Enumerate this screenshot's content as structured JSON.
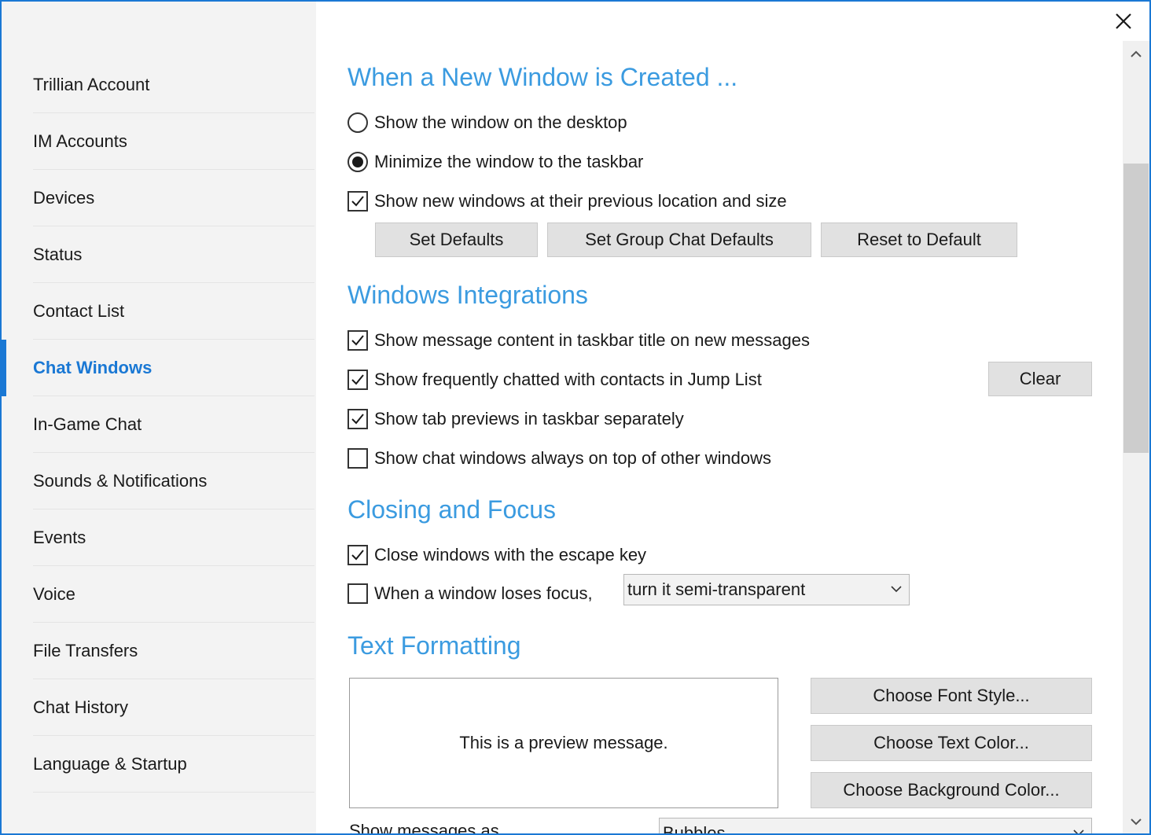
{
  "sidebar": {
    "items": [
      {
        "label": "Trillian Account",
        "active": false
      },
      {
        "label": "IM Accounts",
        "active": false
      },
      {
        "label": "Devices",
        "active": false
      },
      {
        "label": "Status",
        "active": false
      },
      {
        "label": "Contact List",
        "active": false
      },
      {
        "label": "Chat Windows",
        "active": true
      },
      {
        "label": "In-Game Chat",
        "active": false
      },
      {
        "label": "Sounds & Notifications",
        "active": false
      },
      {
        "label": "Events",
        "active": false
      },
      {
        "label": "Voice",
        "active": false
      },
      {
        "label": "File Transfers",
        "active": false
      },
      {
        "label": "Chat History",
        "active": false
      },
      {
        "label": "Language & Startup",
        "active": false
      }
    ]
  },
  "sections": {
    "new_window": {
      "title": "When a New Window is Created ...",
      "show_desktop": "Show the window on the desktop",
      "minimize_taskbar": "Minimize the window to the taskbar",
      "previous_location": "Show new windows at their previous location and size",
      "set_defaults": "Set Defaults",
      "set_group_defaults": "Set Group Chat Defaults",
      "reset_default": "Reset to Default"
    },
    "integrations": {
      "title": "Windows Integrations",
      "message_content": "Show message content in taskbar title on new messages",
      "jump_list": "Show frequently chatted with contacts in Jump List",
      "clear": "Clear",
      "tab_previews": "Show tab previews in taskbar separately",
      "always_on_top": "Show chat windows always on top of other windows"
    },
    "closing": {
      "title": "Closing and Focus",
      "escape_key": "Close windows with the escape key",
      "loses_focus": "When a window loses focus,",
      "focus_action": "turn it semi-transparent"
    },
    "formatting": {
      "title": "Text Formatting",
      "preview_text": "This is a preview message.",
      "font_style": "Choose Font Style...",
      "text_color": "Choose Text Color...",
      "bg_color": "Choose Background Color...",
      "show_messages_as": "Show messages as",
      "show_messages_value": "Bubbles"
    }
  },
  "colors": {
    "accent": "#1a78d4",
    "section_title": "#3b9be0",
    "sidebar_bg": "#f3f3f3",
    "button_bg": "#e1e1e1"
  }
}
